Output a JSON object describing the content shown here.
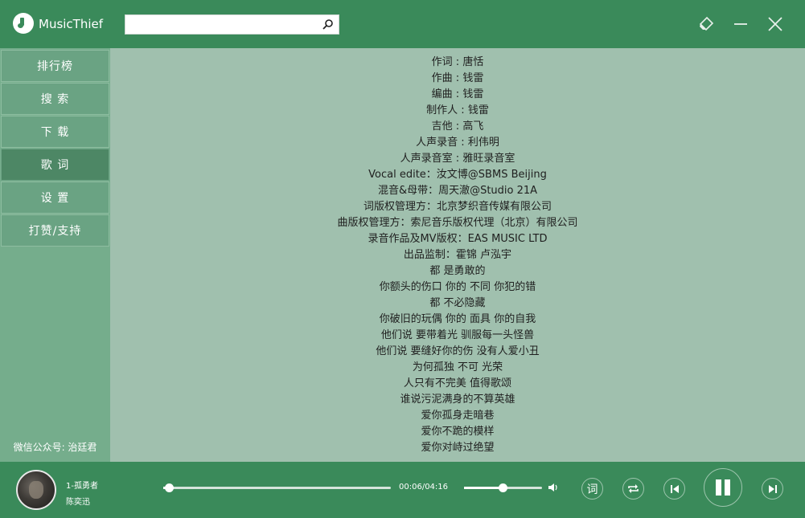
{
  "app": {
    "title": "MusicThief"
  },
  "search": {
    "value": "",
    "placeholder": ""
  },
  "sidebar": {
    "items": [
      {
        "label": "排行榜"
      },
      {
        "label": "搜  索"
      },
      {
        "label": "下  载"
      },
      {
        "label": "歌  词"
      },
      {
        "label": "设  置"
      },
      {
        "label": "打赞/支持"
      }
    ],
    "active_index": 3,
    "footer": "微信公众号: 治廷君"
  },
  "lyrics": [
    "作词 : 唐恬",
    "作曲 : 钱雷",
    "编曲 : 钱雷",
    "制作人 : 钱雷",
    "吉他 : 高飞",
    "人声录音 : 利伟明",
    "人声录音室 : 雅旺录音室",
    "Vocal edite：汝文博@SBMS Beijing",
    "混音&母带：周天澈@Studio 21A",
    "词版权管理方：北京梦织音传媒有限公司",
    "曲版权管理方：索尼音乐版权代理（北京）有限公司",
    "录音作品及MV版权：EAS MUSIC LTD",
    "出品监制：霍锦 卢泓宇",
    "都 是勇敢的",
    "你额头的伤口 你的 不同 你犯的错",
    "都 不必隐藏",
    "你破旧的玩偶 你的 面具 你的自我",
    "他们说 要带着光 驯服每一头怪兽",
    "他们说 要缝好你的伤 没有人爱小丑",
    "为何孤独 不可 光荣",
    "人只有不完美 值得歌颂",
    "谁说污泥满身的不算英雄",
    "爱你孤身走暗巷",
    "爱你不跪的模样",
    "爱你对峙过绝望"
  ],
  "player": {
    "song_title": "1-孤勇者",
    "artist": "陈奕迅",
    "time": "00:06/04:16",
    "progress_fraction": 0.0234,
    "volume_fraction": 0.49,
    "lyric_button_label": "词"
  },
  "colors": {
    "titlebar": "#3a8a5a",
    "sidebar": "#75ad8c",
    "nav_active": "#4d8765",
    "lyrics_bg": "#a0c0ae"
  },
  "icons": {
    "logo": "music-note-icon",
    "search": "search-icon",
    "skin": "skin-icon",
    "minimize": "minimize-icon",
    "close": "close-icon",
    "volume": "volume-icon",
    "repeat": "repeat-icon",
    "prev": "previous-icon",
    "play_pause": "pause-icon",
    "next": "next-icon"
  }
}
